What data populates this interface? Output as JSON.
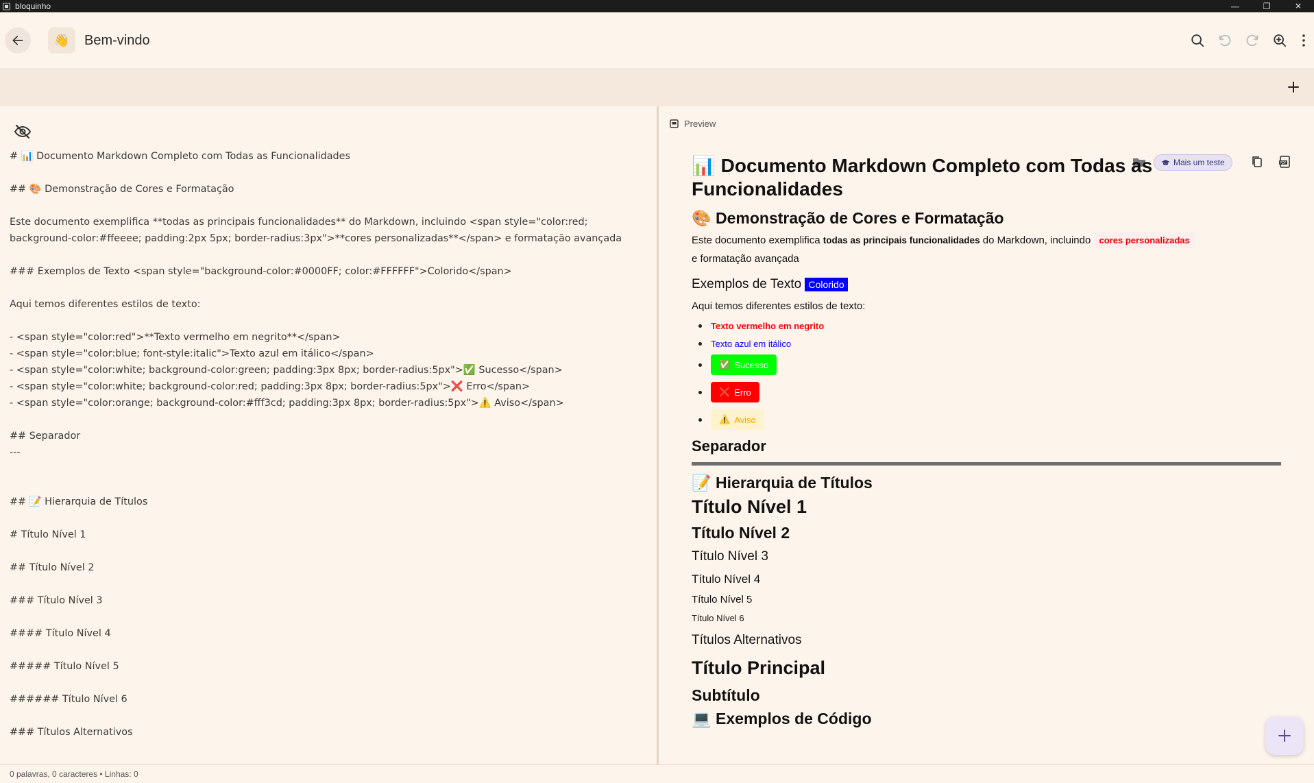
{
  "window": {
    "title": "bloquinho",
    "minimize": "—",
    "maximize": "❐",
    "close": "✕"
  },
  "appbar": {
    "note_emoji": "👋",
    "note_title": "Bem-vindo"
  },
  "editor": {
    "lines": [
      "# 📊 Documento Markdown Completo com Todas as Funcionalidades",
      "",
      "## 🎨 Demonstração de Cores e Formatação",
      "",
      "Este documento exemplifica **todas as principais funcionalidades** do Markdown, incluindo <span style=\"color:red;",
      "background-color:#ffeeee; padding:2px 5px; border-radius:3px\">**cores personalizadas**</span> e formatação avançada",
      "",
      "### Exemplos de Texto <span style=\"background-color:#0000FF; color:#FFFFFF\">Colorido</span>",
      "",
      "Aqui temos diferentes estilos de texto:",
      "",
      "- <span style=\"color:red\">**Texto vermelho em negrito**</span>",
      "- <span style=\"color:blue; font-style:italic\">Texto azul em itálico</span>",
      "- <span style=\"color:white; background-color:green; padding:3px 8px; border-radius:5px\">✅ Sucesso</span>",
      "- <span style=\"color:white; background-color:red; padding:3px 8px; border-radius:5px\">❌ Erro</span>",
      "- <span style=\"color:orange; background-color:#fff3cd; padding:3px 8px; border-radius:5px\">⚠️ Aviso</span>",
      "",
      "## Separador",
      "---",
      "",
      "",
      "## 📝 Hierarquia de Títulos",
      "",
      "# Título Nível 1",
      "",
      "## Título Nível 2",
      "",
      "### Título Nível 3",
      "",
      "#### Título Nível 4",
      "",
      "##### Título Nível 5",
      "",
      "###### Título Nível 6",
      "",
      "### Títulos Alternativos"
    ]
  },
  "preview": {
    "label": "Preview",
    "tag_label": "Mais um teste",
    "h1_emoji": "📊",
    "h1": "Documento Markdown Completo com Todas as Funcionalidades",
    "h2_colors_emoji": "🎨",
    "h2_colors": "Demonstração de Cores e Formatação",
    "para_pre": "Este documento exemplifica ",
    "para_bold": "todas as principais funcionalidades",
    "para_mid": " do Markdown, incluindo ",
    "para_red": "cores personalizadas",
    "para_post": " e formatação avançada",
    "h3_text": "Exemplos de Texto",
    "h3_badge": "Colorido",
    "styles_intro": "Aqui temos diferentes estilos de texto:",
    "list": {
      "red_bold": "Texto vermelho em negrito",
      "blue_italic": "Texto azul em itálico",
      "success_icon": "✅",
      "success": "Sucesso",
      "error_icon": "❌",
      "error": "Erro",
      "warning_icon": "⚠️",
      "warning": "Aviso"
    },
    "separator_title": "Separador",
    "hierarchy_emoji": "📝",
    "hierarchy_title": "Hierarquia de Títulos",
    "t1": "Título Nível 1",
    "t2": "Título Nível 2",
    "t3": "Título Nível 3",
    "t4": "Título Nível 4",
    "t5": "Título Nível 5",
    "t6": "Título Nível 6",
    "alt_titles": "Títulos Alternativos",
    "main_title": "Título Principal",
    "subtitle": "Subtítulo",
    "code_emoji": "💻",
    "code_title": "Exemplos de Código"
  },
  "statusbar": {
    "text": "0 palavras, 0 caracteres • Linhas: 0"
  },
  "colors": {
    "background": "#fdf4ec",
    "tabstrip": "#f4e9dc",
    "success_bg": "#00ff00",
    "error_bg": "#ff0000",
    "warning_bg": "#fff3cd",
    "warning_fg": "#ffa500",
    "badge_blue": "#0000FF",
    "red_text": "#ff0000",
    "blue_text": "#0000ff"
  }
}
